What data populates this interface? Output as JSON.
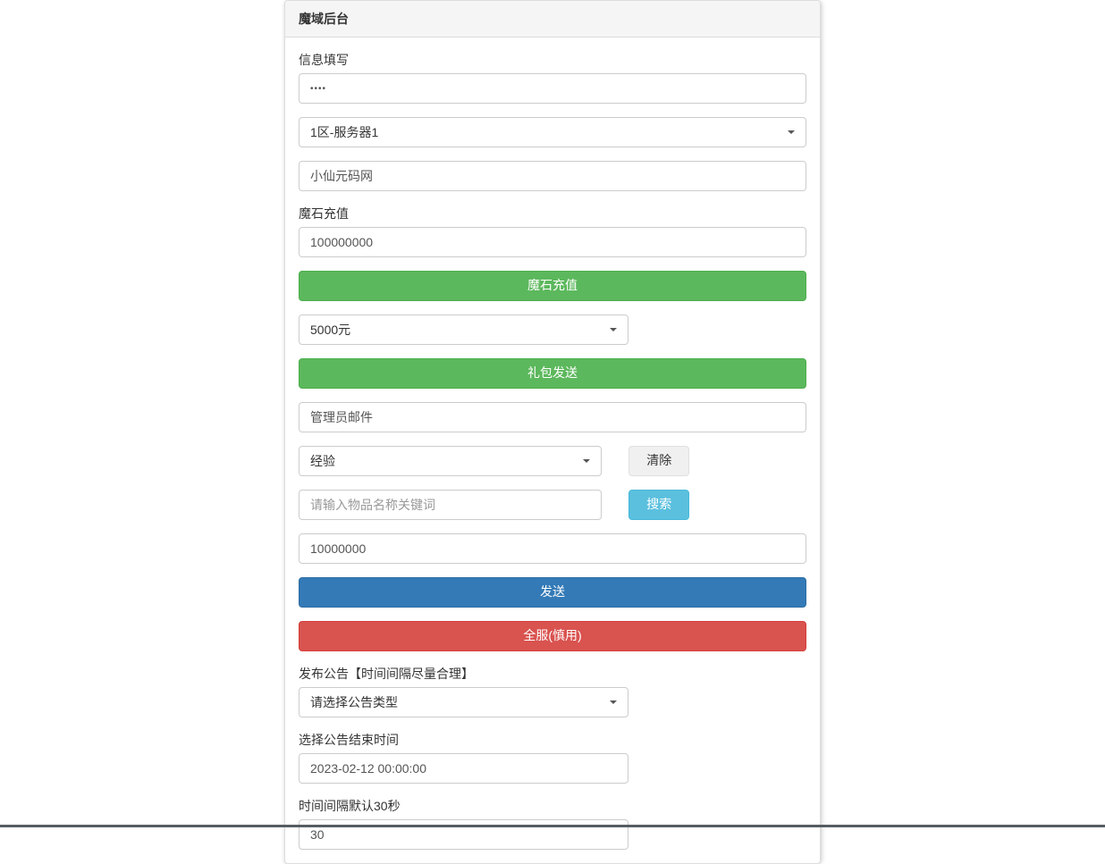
{
  "panel": {
    "title": "魔域后台"
  },
  "info": {
    "label": "信息填写",
    "password_value": "••••",
    "server_selected": "1区-服务器1",
    "name_value": "小仙元码网"
  },
  "recharge": {
    "label": "魔石充值",
    "amount_value": "100000000",
    "button": "魔石充值",
    "package_selected": "5000元",
    "package_button": "礼包发送"
  },
  "mail": {
    "value": "管理员邮件",
    "type_selected": "经验",
    "clear_button": "清除",
    "search_placeholder": "请输入物品名称关键词",
    "search_button": "搜索",
    "quantity_value": "10000000",
    "send_button": "发送",
    "allserver_button": "全服(慎用)"
  },
  "announce": {
    "label": "发布公告【时间间隔尽量合理】",
    "type_selected": "请选择公告类型",
    "end_label": "选择公告结束时间",
    "end_value": "2023-02-12 00:00:00",
    "interval_label": "时间间隔默认30秒",
    "interval_value": "30"
  }
}
